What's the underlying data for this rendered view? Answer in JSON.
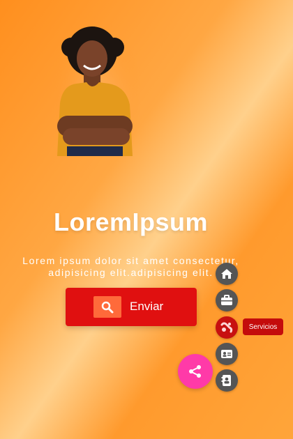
{
  "hero": {
    "title": "LoremIpsum",
    "description_line1": "Lorem ipsum dolor sit amet consectetur,",
    "description_line2": "adipisicing elit.adipisicing elit."
  },
  "cta": {
    "label": "Enviar",
    "icon": "search-icon"
  },
  "fab_menu": {
    "items": [
      {
        "icon": "home-icon"
      },
      {
        "icon": "briefcase-icon"
      },
      {
        "icon": "services-icon",
        "tooltip": "Servicios",
        "active": true
      },
      {
        "icon": "id-card-icon"
      },
      {
        "icon": "contact-book-icon"
      }
    ],
    "toggle_icon": "share-icon"
  },
  "colors": {
    "accent_red": "#e01010",
    "share_pink": "#ff3aa8",
    "menu_gray": "#555555",
    "background_orange": "#ff9a2d"
  }
}
